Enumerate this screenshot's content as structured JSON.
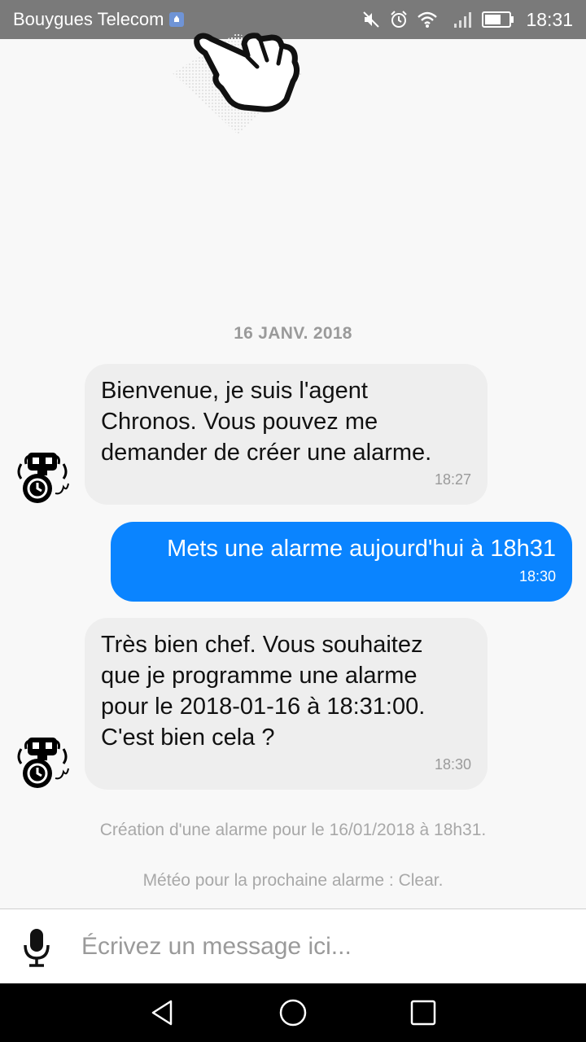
{
  "status_bar": {
    "carrier": "Bouygues Telecom",
    "time": "18:31",
    "icons": [
      "mute-icon",
      "alarm-icon",
      "wifi-icon",
      "signal-icon",
      "battery-icon"
    ]
  },
  "chat": {
    "date": "16 JANV. 2018",
    "messages": [
      {
        "sender": "bot",
        "text": "Bienvenue, je suis l'agent\nChronos. Vous pouvez me\ndemander de créer une alarme.",
        "time": "18:27"
      },
      {
        "sender": "user",
        "text": "Mets une alarme aujourd'hui à 18h31",
        "time": "18:30"
      },
      {
        "sender": "bot",
        "text": "Très bien chef. Vous souhaitez\nque je programme une alarme\npour le 2018-01-16 à 18:31:00.\nC'est bien cela ?",
        "time": "18:30"
      }
    ],
    "system_messages": [
      "Création d'une alarme pour le 16/01/2018 à 18h31.",
      "Météo pour la prochaine alarme : Clear."
    ]
  },
  "input": {
    "placeholder": "Écrivez un message ici..."
  },
  "colors": {
    "user_bubble": "#0a84ff",
    "bot_bubble": "#eeeeee",
    "status_bar": "#7a7a7a"
  }
}
